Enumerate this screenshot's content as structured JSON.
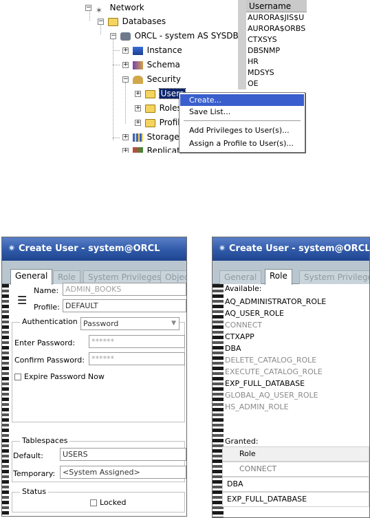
{
  "tree": {
    "items": [
      {
        "label": "Network",
        "icon": "network-icon"
      },
      {
        "label": "Databases",
        "icon": "folder-icon"
      },
      {
        "label": "ORCL - system AS SYSDBA",
        "icon": "database-icon"
      },
      {
        "label": "Instance",
        "icon": "instance-icon"
      },
      {
        "label": "Schema",
        "icon": "schema-icon"
      },
      {
        "label": "Security",
        "icon": "security-icon"
      },
      {
        "label": "Users",
        "icon": "folder-icon"
      },
      {
        "label": "Roles",
        "icon": "folder-icon"
      },
      {
        "label": "Profile",
        "icon": "folder-icon"
      },
      {
        "label": "Storage",
        "icon": "storage-icon"
      },
      {
        "label": "Replicatio",
        "icon": "replication-icon"
      }
    ]
  },
  "username_list": {
    "header": "Username",
    "rows": [
      "AURORA$JIS$U",
      "AURORA$ORBS",
      "CTXSYS",
      "DBSNMP",
      "HR",
      "MDSYS",
      "OE"
    ]
  },
  "context_menu": {
    "items": [
      "Create...",
      "Save List...",
      "Add Privileges to User(s)...",
      "Assign a Profile to User(s)..."
    ]
  },
  "dialog_general": {
    "title": "Create User - system@ORCL",
    "tabs": [
      "General",
      "Role",
      "System Privileges",
      "Objec"
    ],
    "name_label": "Name:",
    "name_value": "ADMIN_BOOKS",
    "profile_label": "Profile:",
    "profile_value": "DEFAULT",
    "auth_label": "Authentication",
    "auth_value": "Password",
    "enter_password_label": "Enter Password:",
    "enter_password_value": "******",
    "confirm_password_label": "Confirm Password:",
    "confirm_password_value": "******",
    "expire_label": "Expire Password Now",
    "tablespaces_label": "Tablespaces",
    "default_label": "Default:",
    "default_value": "USERS",
    "temporary_label": "Temporary:",
    "temporary_value": "<System Assigned>",
    "status_label": "Status",
    "locked_label": "Locked"
  },
  "dialog_role": {
    "title": "Create User - system@ORCL",
    "tabs": [
      "General",
      "Role",
      "System Privilege"
    ],
    "available_label": "Available:",
    "available_roles": [
      {
        "name": "AQ_ADMINISTRATOR_ROLE",
        "muted": false
      },
      {
        "name": "AQ_USER_ROLE",
        "muted": false
      },
      {
        "name": "CONNECT",
        "muted": true
      },
      {
        "name": "CTXAPP",
        "muted": false
      },
      {
        "name": "DBA",
        "muted": false
      },
      {
        "name": "DELETE_CATALOG_ROLE",
        "muted": true
      },
      {
        "name": "EXECUTE_CATALOG_ROLE",
        "muted": true
      },
      {
        "name": "EXP_FULL_DATABASE",
        "muted": false
      },
      {
        "name": "GLOBAL_AQ_USER_ROLE",
        "muted": true
      },
      {
        "name": "HS_ADMIN_ROLE",
        "muted": true
      }
    ],
    "granted_label": "Granted:",
    "granted_header": "Role",
    "granted_roles": [
      "CONNECT",
      "DBA",
      "EXP_FULL_DATABASE"
    ]
  },
  "colors": {
    "titlebar": "#2f5aa8",
    "selection": "#0a246a",
    "menu_highlight": "#3a5fcd"
  }
}
